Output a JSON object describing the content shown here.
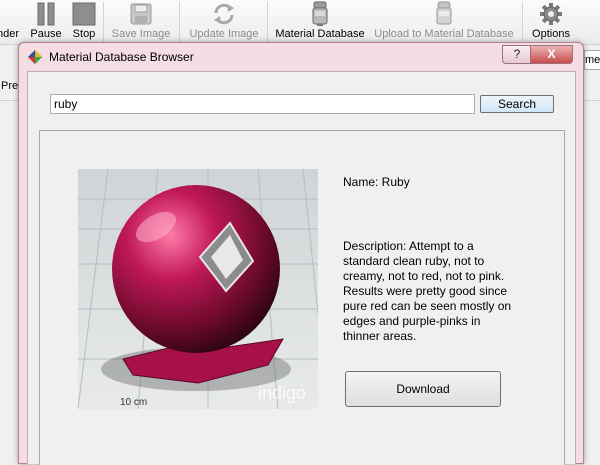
{
  "toolbar": {
    "render_label": "nder",
    "pause_label": "Pause",
    "stop_label": "Stop",
    "save_image_label": "Save Image",
    "update_image_label": "Update Image",
    "material_database_label": "Material Database",
    "upload_label": "Upload to Material Database",
    "options_label": "Options"
  },
  "background": {
    "left_tab_fragment": "Pre",
    "right_field_fragment": "me"
  },
  "dialog": {
    "title": "Material Database Browser",
    "help_label": "?",
    "close_label": "X",
    "search": {
      "value": "ruby",
      "button_label": "Search"
    },
    "material": {
      "name_line": "Name: Ruby",
      "description": "Description: Attempt to a standard clean ruby, not to creamy, not to red, not to pink. Results were pretty good since pure red can be seen mostly on edges and purple-pinks in thinner areas.",
      "download_label": "Download",
      "preview_ruler_text": "10 cm",
      "preview_watermark": "indigo"
    }
  },
  "colors": {
    "dialog_frame": "#f4dde3",
    "ruby": "#c01858",
    "search_button": "#cfe6f7"
  }
}
